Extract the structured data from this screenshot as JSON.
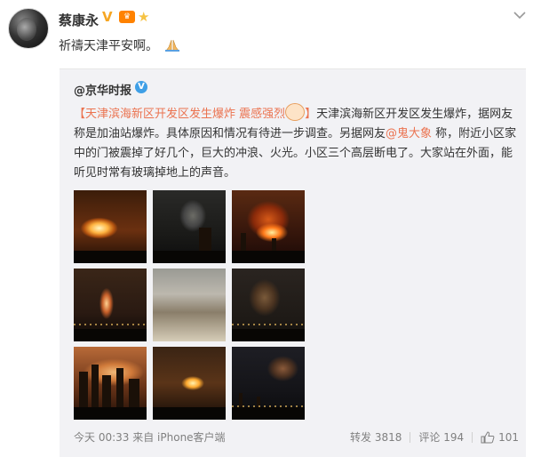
{
  "author": {
    "name": "蔡康永",
    "badges": [
      "vip-v-icon",
      "level-badge",
      "star-badge"
    ]
  },
  "post": {
    "text": "祈禱天津平安啊。",
    "emoji": "praying-hands-icon"
  },
  "repost": {
    "source_prefix": "@",
    "source_name": "京华时报",
    "headline": "【天津滨海新区开发区发生爆炸 震感强烈",
    "headline_close": "】",
    "body_part1": "天津滨海新区开发区发生爆炸，据网友称是加油站爆炸。具体原因和情况有待进一步调查。另据网友",
    "mention": "@鬼大象",
    "body_part2": " 称，附近小区家中的门被震掉了好几个，巨大的冲浪、火光。小区三个高层断电了。大家站在外面，能听见时常有玻璃掉地上的声音。",
    "photo_count": 9,
    "meta_time": "今天 00:33",
    "meta_from": "来自 iPhone客户端",
    "repost_label": "转发",
    "repost_count": "3818",
    "comment_label": "评论",
    "comment_count": "194",
    "like_count": "101"
  },
  "colors": {
    "link_orange": "#eb7350",
    "verified_blue": "#3f9fe6",
    "repost_bg": "#f2f2f5",
    "meta_gray": "#808080"
  }
}
